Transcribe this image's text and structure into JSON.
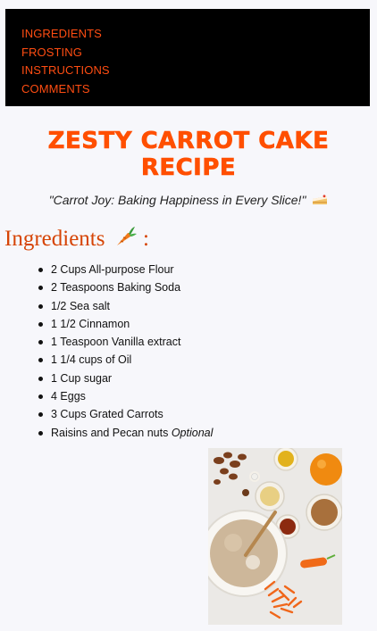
{
  "nav": {
    "items": [
      "INGREDIENTS",
      "FROSTING",
      "INSTRUCTIONS",
      "COMMENTS"
    ]
  },
  "header": {
    "title_line1": "ZESTY CARROT CAKE",
    "title_line2": "RECIPE",
    "tagline": "\"Carrot Joy: Baking Happiness in Every Slice!\""
  },
  "ingredients": {
    "heading": "Ingredients",
    "heading_suffix": ":",
    "items": [
      "2 Cups All-purpose Flour",
      "2 Teaspoons Baking Soda",
      "1/2 Sea salt",
      "1 1/2 Cinnamon",
      "1 Teaspoon Vanilla extract",
      "1 1/4 cups of Oil",
      "1 Cup sugar",
      "4 Eggs",
      "3 Cups Grated Carrots"
    ],
    "last_item_text": "Raisins and Pecan nuts",
    "last_item_note": "Optional"
  },
  "icons": {
    "carrot": "carrot-icon",
    "cake": "cake-slice-icon"
  },
  "colors": {
    "accent": "#ff4f00",
    "heading": "#d64405",
    "nav_background": "#000000"
  }
}
